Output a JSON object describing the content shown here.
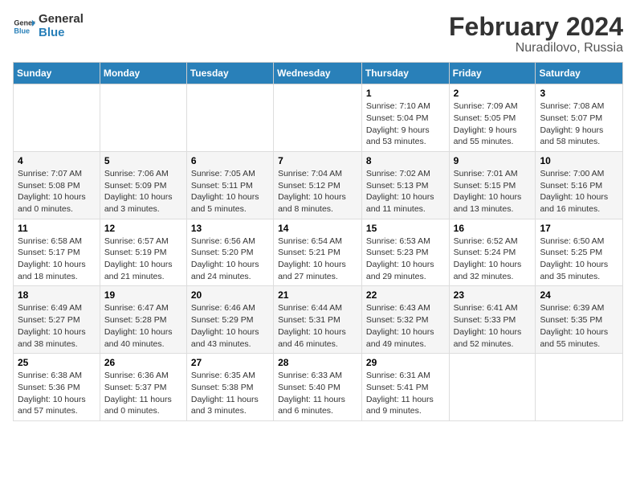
{
  "logo": {
    "text_general": "General",
    "text_blue": "Blue"
  },
  "title": "February 2024",
  "subtitle": "Nuradilovo, Russia",
  "days_of_week": [
    "Sunday",
    "Monday",
    "Tuesday",
    "Wednesday",
    "Thursday",
    "Friday",
    "Saturday"
  ],
  "weeks": [
    [
      {
        "day": "",
        "info": ""
      },
      {
        "day": "",
        "info": ""
      },
      {
        "day": "",
        "info": ""
      },
      {
        "day": "",
        "info": ""
      },
      {
        "day": "1",
        "info": "Sunrise: 7:10 AM\nSunset: 5:04 PM\nDaylight: 9 hours\nand 53 minutes."
      },
      {
        "day": "2",
        "info": "Sunrise: 7:09 AM\nSunset: 5:05 PM\nDaylight: 9 hours\nand 55 minutes."
      },
      {
        "day": "3",
        "info": "Sunrise: 7:08 AM\nSunset: 5:07 PM\nDaylight: 9 hours\nand 58 minutes."
      }
    ],
    [
      {
        "day": "4",
        "info": "Sunrise: 7:07 AM\nSunset: 5:08 PM\nDaylight: 10 hours\nand 0 minutes."
      },
      {
        "day": "5",
        "info": "Sunrise: 7:06 AM\nSunset: 5:09 PM\nDaylight: 10 hours\nand 3 minutes."
      },
      {
        "day": "6",
        "info": "Sunrise: 7:05 AM\nSunset: 5:11 PM\nDaylight: 10 hours\nand 5 minutes."
      },
      {
        "day": "7",
        "info": "Sunrise: 7:04 AM\nSunset: 5:12 PM\nDaylight: 10 hours\nand 8 minutes."
      },
      {
        "day": "8",
        "info": "Sunrise: 7:02 AM\nSunset: 5:13 PM\nDaylight: 10 hours\nand 11 minutes."
      },
      {
        "day": "9",
        "info": "Sunrise: 7:01 AM\nSunset: 5:15 PM\nDaylight: 10 hours\nand 13 minutes."
      },
      {
        "day": "10",
        "info": "Sunrise: 7:00 AM\nSunset: 5:16 PM\nDaylight: 10 hours\nand 16 minutes."
      }
    ],
    [
      {
        "day": "11",
        "info": "Sunrise: 6:58 AM\nSunset: 5:17 PM\nDaylight: 10 hours\nand 18 minutes."
      },
      {
        "day": "12",
        "info": "Sunrise: 6:57 AM\nSunset: 5:19 PM\nDaylight: 10 hours\nand 21 minutes."
      },
      {
        "day": "13",
        "info": "Sunrise: 6:56 AM\nSunset: 5:20 PM\nDaylight: 10 hours\nand 24 minutes."
      },
      {
        "day": "14",
        "info": "Sunrise: 6:54 AM\nSunset: 5:21 PM\nDaylight: 10 hours\nand 27 minutes."
      },
      {
        "day": "15",
        "info": "Sunrise: 6:53 AM\nSunset: 5:23 PM\nDaylight: 10 hours\nand 29 minutes."
      },
      {
        "day": "16",
        "info": "Sunrise: 6:52 AM\nSunset: 5:24 PM\nDaylight: 10 hours\nand 32 minutes."
      },
      {
        "day": "17",
        "info": "Sunrise: 6:50 AM\nSunset: 5:25 PM\nDaylight: 10 hours\nand 35 minutes."
      }
    ],
    [
      {
        "day": "18",
        "info": "Sunrise: 6:49 AM\nSunset: 5:27 PM\nDaylight: 10 hours\nand 38 minutes."
      },
      {
        "day": "19",
        "info": "Sunrise: 6:47 AM\nSunset: 5:28 PM\nDaylight: 10 hours\nand 40 minutes."
      },
      {
        "day": "20",
        "info": "Sunrise: 6:46 AM\nSunset: 5:29 PM\nDaylight: 10 hours\nand 43 minutes."
      },
      {
        "day": "21",
        "info": "Sunrise: 6:44 AM\nSunset: 5:31 PM\nDaylight: 10 hours\nand 46 minutes."
      },
      {
        "day": "22",
        "info": "Sunrise: 6:43 AM\nSunset: 5:32 PM\nDaylight: 10 hours\nand 49 minutes."
      },
      {
        "day": "23",
        "info": "Sunrise: 6:41 AM\nSunset: 5:33 PM\nDaylight: 10 hours\nand 52 minutes."
      },
      {
        "day": "24",
        "info": "Sunrise: 6:39 AM\nSunset: 5:35 PM\nDaylight: 10 hours\nand 55 minutes."
      }
    ],
    [
      {
        "day": "25",
        "info": "Sunrise: 6:38 AM\nSunset: 5:36 PM\nDaylight: 10 hours\nand 57 minutes."
      },
      {
        "day": "26",
        "info": "Sunrise: 6:36 AM\nSunset: 5:37 PM\nDaylight: 11 hours\nand 0 minutes."
      },
      {
        "day": "27",
        "info": "Sunrise: 6:35 AM\nSunset: 5:38 PM\nDaylight: 11 hours\nand 3 minutes."
      },
      {
        "day": "28",
        "info": "Sunrise: 6:33 AM\nSunset: 5:40 PM\nDaylight: 11 hours\nand 6 minutes."
      },
      {
        "day": "29",
        "info": "Sunrise: 6:31 AM\nSunset: 5:41 PM\nDaylight: 11 hours\nand 9 minutes."
      },
      {
        "day": "",
        "info": ""
      },
      {
        "day": "",
        "info": ""
      }
    ]
  ]
}
